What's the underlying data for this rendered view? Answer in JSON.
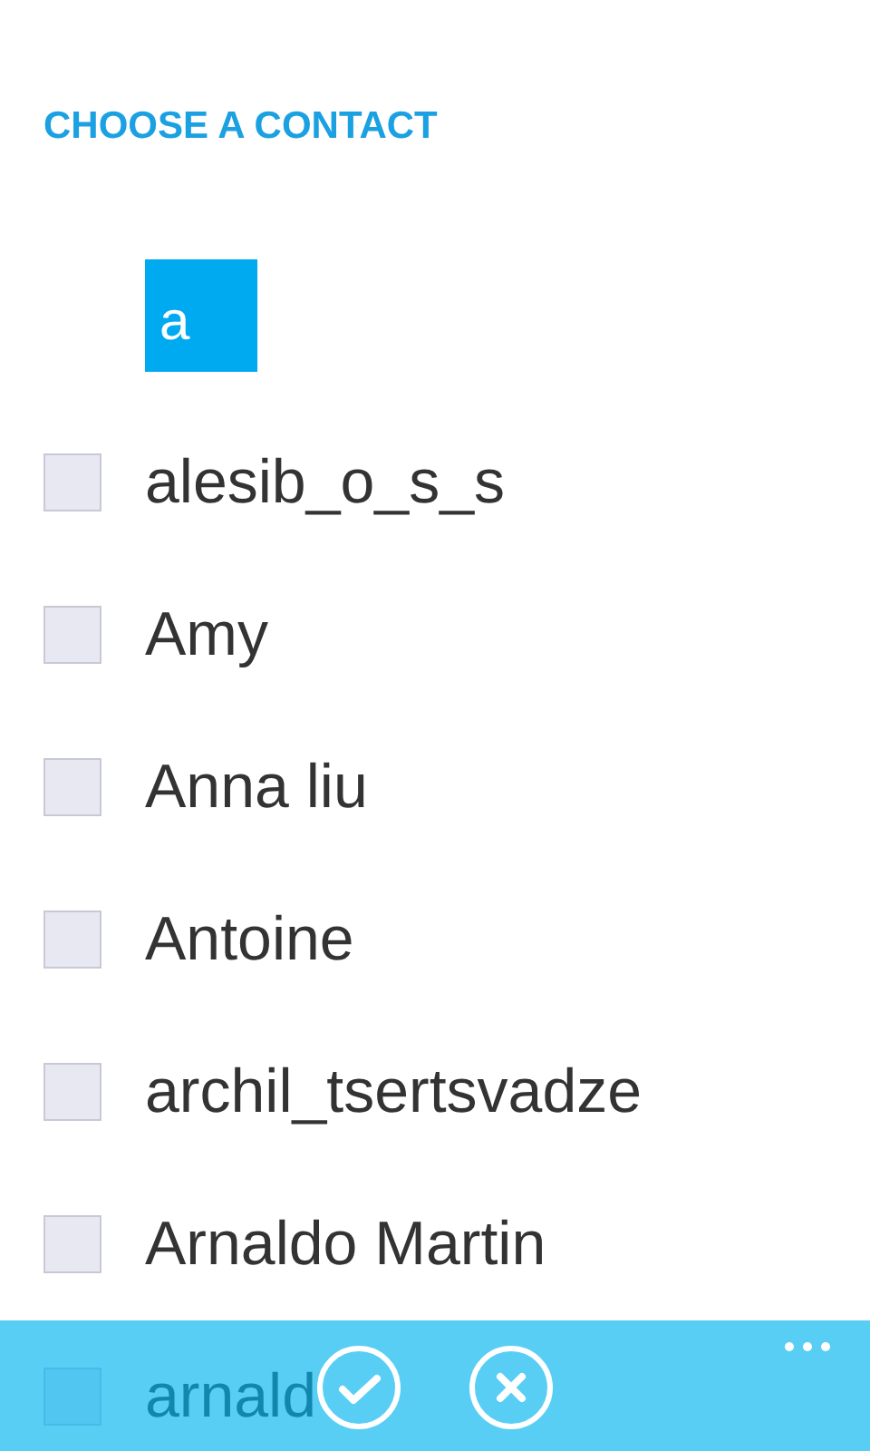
{
  "header": {
    "title": "CHOOSE A CONTACT"
  },
  "group_header": {
    "letter": "a"
  },
  "contacts": [
    {
      "name": "alesib_o_s_s",
      "checked": false
    },
    {
      "name": "Amy",
      "checked": false
    },
    {
      "name": "Anna liu",
      "checked": false
    },
    {
      "name": "Antoine",
      "checked": false
    },
    {
      "name": "archil_tsertsvadze",
      "checked": false
    },
    {
      "name": "Arnaldo Martin",
      "checked": false
    },
    {
      "name": "arnald",
      "checked": false
    }
  ],
  "app_bar": {
    "buttons": [
      {
        "kind": "confirm"
      },
      {
        "kind": "cancel"
      }
    ]
  }
}
